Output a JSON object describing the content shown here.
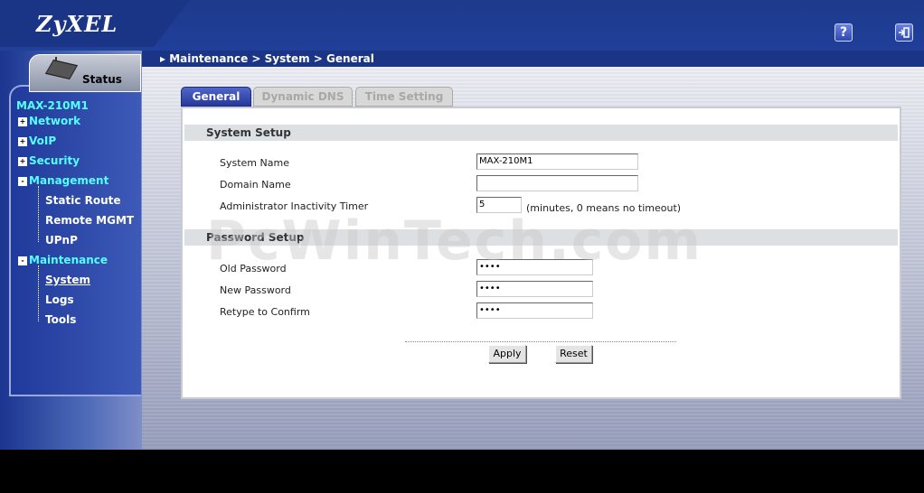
{
  "header": {
    "logo": "ZyXEL",
    "help_icon": "?",
    "logout_icon": "logout-icon"
  },
  "sidebar": {
    "status_label": "Status",
    "model": "MAX-210M1",
    "items": [
      {
        "label": "Network",
        "expander": "+"
      },
      {
        "label": "VoIP",
        "expander": "+"
      },
      {
        "label": "Security",
        "expander": "+"
      },
      {
        "label": "Management",
        "expander": "-"
      },
      {
        "label": "Maintenance",
        "expander": "-"
      }
    ],
    "management_sub": [
      "Static Route",
      "Remote MGMT",
      "UPnP"
    ],
    "maintenance_sub": [
      "System",
      "Logs",
      "Tools"
    ]
  },
  "breadcrumb": "Maintenance > System > General",
  "tabs": [
    "General",
    "Dynamic DNS",
    "Time Setting"
  ],
  "system_setup": {
    "title": "System Setup",
    "system_name_label": "System Name",
    "system_name_value": "MAX-210M1",
    "domain_name_label": "Domain Name",
    "domain_name_value": "",
    "timer_label": "Administrator Inactivity Timer",
    "timer_value": "5",
    "timer_hint": "(minutes, 0 means no timeout)"
  },
  "password_setup": {
    "title": "Password Setup",
    "old_label": "Old Password",
    "old_value": "••••",
    "new_label": "New Password",
    "new_value": "••••",
    "confirm_label": "Retype to Confirm",
    "confirm_value": "••••"
  },
  "buttons": {
    "apply": "Apply",
    "reset": "Reset"
  },
  "watermark": "PcWinTech.com"
}
